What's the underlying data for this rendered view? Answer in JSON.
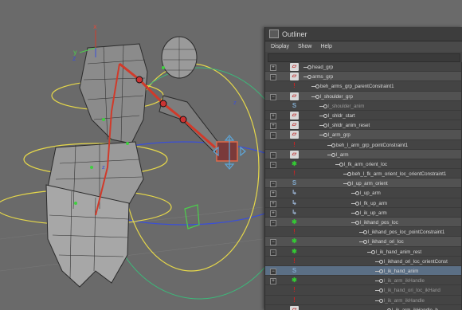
{
  "viewport": {
    "axis_labels": {
      "x_red": "x",
      "y_green": "y",
      "z_blue": "z",
      "z_small": "z",
      "z_small2": "z"
    }
  },
  "outliner": {
    "title": "Outliner",
    "menu": [
      "Display",
      "Show",
      "Help"
    ],
    "items": [
      {
        "label": "head_grp",
        "icon": "grp",
        "expander": "+",
        "indent": 0,
        "shade": false
      },
      {
        "label": "arms_grp",
        "icon": "grp",
        "expander": "−",
        "indent": 0,
        "shade": true
      },
      {
        "label": "beh_arms_grp_parentConstraint1",
        "icon": "con",
        "expander": "",
        "indent": 1,
        "shade": false
      },
      {
        "label": "l_shoulder_grp",
        "icon": "grp",
        "expander": "−",
        "indent": 1,
        "shade": true
      },
      {
        "label": "l_shoulder_anim",
        "icon": "jnt",
        "expander": "",
        "indent": 2,
        "shade": false,
        "dim": true
      },
      {
        "label": "l_shldr_start",
        "icon": "grp",
        "expander": "+",
        "indent": 2,
        "shade": false
      },
      {
        "label": "l_shldr_anim_reset",
        "icon": "grp",
        "expander": "+",
        "indent": 2,
        "shade": false
      },
      {
        "label": "l_arm_grp",
        "icon": "grp",
        "expander": "−",
        "indent": 2,
        "shade": true
      },
      {
        "label": "beh_l_arm_grp_pointConstraint1",
        "icon": "con",
        "expander": "",
        "indent": 3,
        "shade": false
      },
      {
        "label": "l_arm",
        "icon": "grp",
        "expander": "−",
        "indent": 3,
        "shade": true
      },
      {
        "label": "l_fk_arm_orient_loc",
        "icon": "loc",
        "expander": "−",
        "indent": 4,
        "shade": false
      },
      {
        "label": "beh_l_fk_arm_orient_loc_orientConstraint1",
        "icon": "con",
        "expander": "",
        "indent": 5,
        "shade": false
      },
      {
        "label": "l_up_arm_orient",
        "icon": "jnt",
        "expander": "−",
        "indent": 5,
        "shade": true
      },
      {
        "label": "l_up_arm",
        "icon": "par",
        "expander": "+",
        "indent": 6,
        "shade": false
      },
      {
        "label": "l_fk_up_arm",
        "icon": "par",
        "expander": "+",
        "indent": 6,
        "shade": false
      },
      {
        "label": "l_ik_up_arm",
        "icon": "par",
        "expander": "+",
        "indent": 6,
        "shade": false
      },
      {
        "label": "l_ikhand_pos_loc",
        "icon": "loc",
        "expander": "−",
        "indent": 6,
        "shade": true
      },
      {
        "label": "l_ikhand_pos_loc_pointConstraint1",
        "icon": "con",
        "expander": "",
        "indent": 7,
        "shade": false
      },
      {
        "label": "l_ikhand_ori_loc",
        "icon": "loc",
        "expander": "−",
        "indent": 7,
        "shade": true
      },
      {
        "label": "l_ik_hand_anim_rest",
        "icon": "loc",
        "expander": "−",
        "indent": 8,
        "shade": false
      },
      {
        "label": "l_ikhand_ori_loc_orientConst",
        "icon": "con",
        "expander": "",
        "indent": 9,
        "shade": false
      },
      {
        "label": "l_ik_hand_anim",
        "icon": "jnt",
        "expander": "−",
        "indent": 9,
        "shade": false,
        "selected": true
      },
      {
        "label": "l_ik_arm_ikHandle",
        "icon": "loc",
        "expander": "+",
        "indent": 9,
        "shade": false,
        "dim": true
      },
      {
        "label": "l_ik_hand_ori_loc_ikHand",
        "icon": "con",
        "expander": "",
        "indent": 9,
        "shade": false,
        "dim": true
      },
      {
        "label": "l_ik_arm_ikHandle",
        "icon": "con",
        "expander": "",
        "indent": 9,
        "shade": false,
        "dim": true
      },
      {
        "label": "l_ik_arm_ikHandle_b",
        "icon": "grp",
        "expander": "",
        "indent": 10,
        "shade": false
      }
    ]
  }
}
